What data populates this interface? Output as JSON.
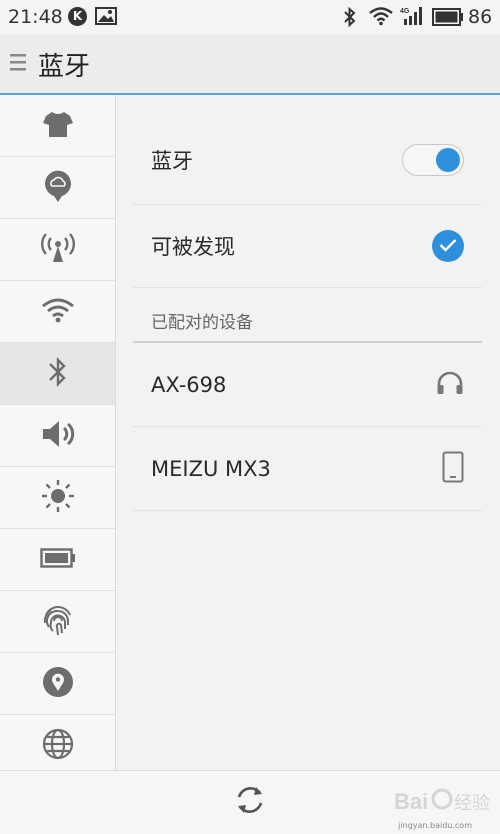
{
  "status_bar": {
    "time": "21:48",
    "k_badge": "K",
    "battery_level": "86"
  },
  "header": {
    "title": "蓝牙"
  },
  "sidebar": {
    "items": [
      {
        "icon": "shirt-icon"
      },
      {
        "icon": "cloud-icon"
      },
      {
        "icon": "hotspot-icon"
      },
      {
        "icon": "wifi-icon"
      },
      {
        "icon": "bluetooth-icon",
        "active": true
      },
      {
        "icon": "volume-icon"
      },
      {
        "icon": "brightness-icon"
      },
      {
        "icon": "battery-icon"
      },
      {
        "icon": "fingerprint-icon"
      },
      {
        "icon": "location-icon"
      },
      {
        "icon": "globe-icon"
      }
    ]
  },
  "main": {
    "bluetooth_label": "蓝牙",
    "bluetooth_on": true,
    "discoverable_label": "可被发现",
    "discoverable_checked": true,
    "paired_section": "已配对的设备",
    "devices": [
      {
        "name": "AX-698",
        "icon": "headphones-icon"
      },
      {
        "name": "MEIZU MX3",
        "icon": "phone-icon"
      }
    ]
  },
  "bottom_bar": {
    "refresh_icon": "refresh-icon",
    "watermark_url": "jingyan.baidu.com"
  },
  "colors": {
    "accent": "#2e8fdc",
    "header_line": "#5aa4d6",
    "icon_gray": "#6d6d6d"
  }
}
